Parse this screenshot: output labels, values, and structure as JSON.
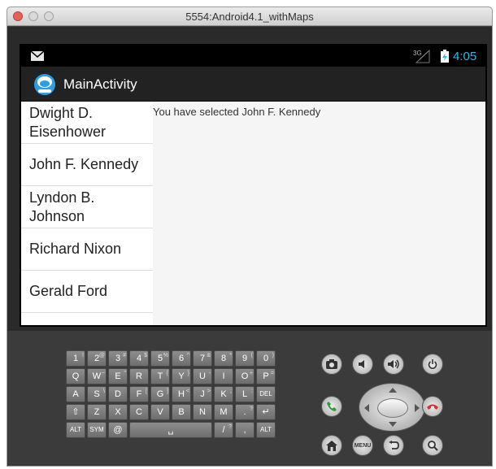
{
  "window": {
    "title": "5554:Android4.1_withMaps"
  },
  "statusbar": {
    "time": "4:05",
    "network": "3G"
  },
  "actionbar": {
    "title": "MainActivity"
  },
  "list": {
    "items": [
      {
        "label": "Dwight D. Eisenhower"
      },
      {
        "label": "John F. Kennedy"
      },
      {
        "label": "Lyndon B. Johnson"
      },
      {
        "label": "Richard Nixon"
      },
      {
        "label": "Gerald Ford"
      }
    ]
  },
  "detail": {
    "text": "You have selected John F. Kennedy"
  },
  "keyboard": {
    "row1": [
      "1",
      "2",
      "3",
      "4",
      "5",
      "6",
      "7",
      "8",
      "9",
      "0"
    ],
    "row1_sup": [
      "!",
      "@",
      "#",
      "$",
      "%",
      "^",
      "&",
      "*",
      "(",
      ")"
    ],
    "row2": [
      "Q",
      "W",
      "E",
      "R",
      "T",
      "Y",
      "U",
      "I",
      "O",
      "P"
    ],
    "row2_sup": [
      "",
      "~",
      "\"",
      "",
      "{",
      "}",
      "-",
      "",
      "+",
      "="
    ],
    "row3": [
      "A",
      "S",
      "D",
      "F",
      "G",
      "H",
      "J",
      "K",
      "L",
      "DEL"
    ],
    "row3_sup": [
      "",
      "\\",
      "",
      "[",
      "]",
      "<",
      ">",
      ";",
      ":",
      ""
    ],
    "row4": [
      "⇧",
      "Z",
      "X",
      "C",
      "V",
      "B",
      "N",
      "M",
      ".",
      "↵"
    ],
    "row4_sup": [
      "",
      "",
      "",
      "",
      "",
      "",
      "",
      "",
      "?",
      ""
    ],
    "row5": [
      "ALT",
      "SYM",
      "@",
      "␣",
      "/",
      ",",
      "ALT"
    ],
    "row5_sup": [
      "",
      "",
      "",
      "",
      "?",
      "",
      ""
    ]
  },
  "hardware": {
    "buttons": [
      "camera-icon",
      "volume-down-icon",
      "volume-up-icon",
      "power-icon",
      "call-icon",
      "end-call-icon",
      "home-icon",
      "menu-icon",
      "back-icon",
      "search-icon"
    ],
    "menu_label": "MENU"
  },
  "colors": {
    "accent": "#33b5e5",
    "call": "#2e9b3c",
    "end_call": "#d83333"
  }
}
